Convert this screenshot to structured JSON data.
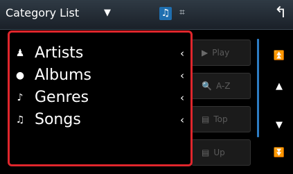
{
  "header": {
    "title": "Category List",
    "dropdown_icon": "triangle-down-icon",
    "source_icons": [
      "music-note-icon",
      "video-icon"
    ],
    "back_icon": "return-arrow-icon"
  },
  "category_list": {
    "items": [
      {
        "label": "Artists",
        "icon": "person-icon"
      },
      {
        "label": "Albums",
        "icon": "disc-icon"
      },
      {
        "label": "Genres",
        "icon": "guitar-icon"
      },
      {
        "label": "Songs",
        "icon": "music-note-icon"
      }
    ],
    "highlight_color": "#e0262c"
  },
  "side_buttons": [
    {
      "label": "Play",
      "icon": "play-icon"
    },
    {
      "label": "A-Z",
      "icon": "search-icon"
    },
    {
      "label": "Top",
      "icon": "folder-top-icon"
    },
    {
      "label": "Up",
      "icon": "folder-up-icon"
    }
  ],
  "scroll": {
    "controls": [
      "scroll-top-icon",
      "scroll-up-icon",
      "scroll-down-icon",
      "scroll-bottom-icon"
    ],
    "accent": "#2d7dc4"
  }
}
